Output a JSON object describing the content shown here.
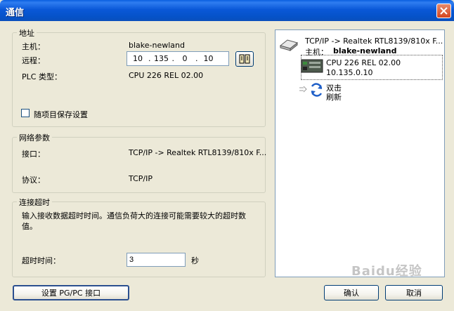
{
  "window": {
    "title": "通信"
  },
  "address": {
    "legend": "地址",
    "host_label": "主机：",
    "host_value": "blake-newland",
    "remote_label": "远程：",
    "ip": [
      "10",
      "135",
      "0",
      "10"
    ],
    "plc_label": "PLC 类型：",
    "plc_value": "CPU 226 REL 02.00",
    "save_label": "随项目保存设置"
  },
  "network": {
    "legend": "网络参数",
    "interface_label": "接口：",
    "interface_value": "TCP/IP -> Realtek RTL8139/810x F...",
    "protocol_label": "协议：",
    "protocol_value": "TCP/IP"
  },
  "timeout": {
    "legend": "连接超时",
    "description": "输入接收数据超时时间。通信负荷大的连接可能需要较大的超时数值。",
    "label": "超时时间：",
    "value": "3",
    "unit": "秒"
  },
  "buttons": {
    "set_pgpc": "设置 PG/PC 接口",
    "ok": "确认",
    "cancel": "取消"
  },
  "tree": {
    "interface": "TCP/IP -> Realtek RTL8139/810x F...",
    "host_label": "主机：",
    "host_value": "blake-newland",
    "cpu_line1": "CPU 226 REL 02.00",
    "cpu_line2": "10.135.0.10",
    "refresh_line1": "双击",
    "refresh_line2": "刷新"
  },
  "watermark": "Baidu经验",
  "colors": {
    "title_bar": "#0a58d8",
    "dialog_bg": "#ece9d8",
    "close_button": "#d4451f"
  }
}
